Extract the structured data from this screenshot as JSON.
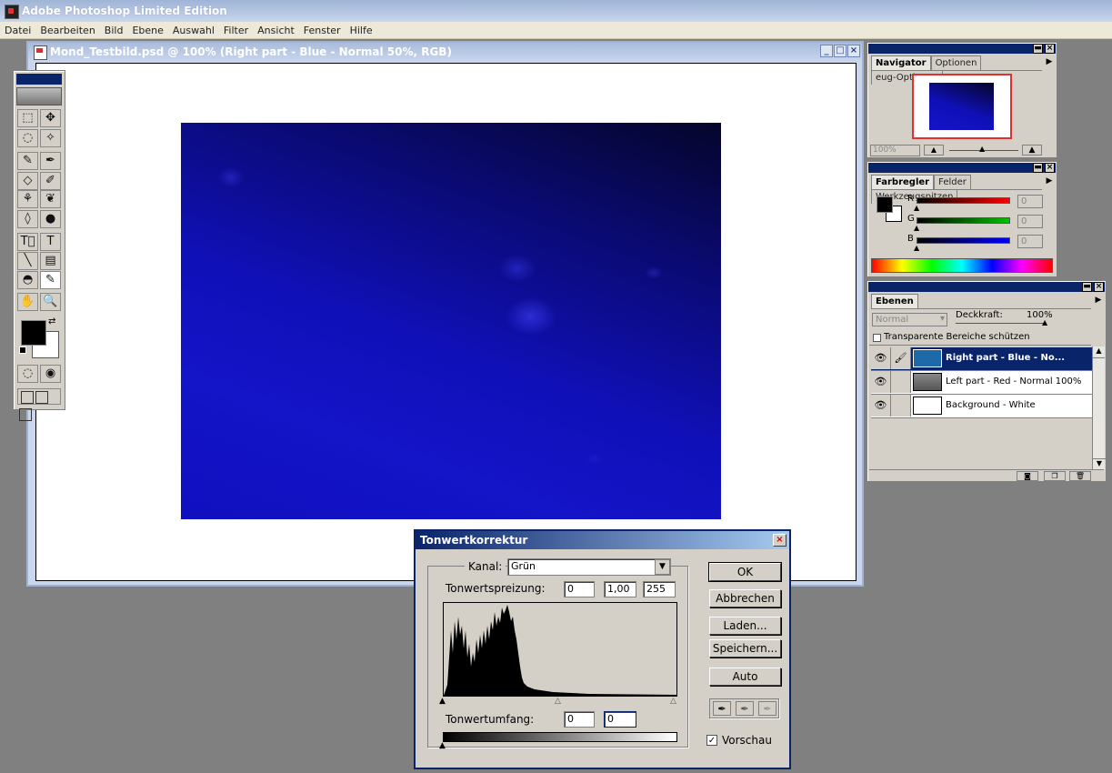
{
  "app": {
    "title": "Adobe Photoshop Limited Edition"
  },
  "menu": [
    "Datei",
    "Bearbeiten",
    "Bild",
    "Ebene",
    "Auswahl",
    "Filter",
    "Ansicht",
    "Fenster",
    "Hilfe"
  ],
  "document": {
    "title": "Mond_Testbild.psd @ 100%  (Right part - Blue - Normal 50%, RGB)",
    "min": "_",
    "max": "□",
    "close": "×"
  },
  "navigator": {
    "tabs": [
      "Navigator",
      "Optionen",
      "eug-Optionen"
    ],
    "zoom": "100%",
    "frame_color": "#e03030"
  },
  "color": {
    "tabs": [
      "Farbregler",
      "Felder",
      "Werkzeugspitzen"
    ],
    "channels": [
      {
        "label": "R",
        "value": "0",
        "color": "#ff0000"
      },
      {
        "label": "G",
        "value": "0",
        "color": "#00c000"
      },
      {
        "label": "B",
        "value": "0",
        "color": "#0000ff"
      }
    ]
  },
  "layers": {
    "tab": "Ebenen",
    "mode": "Normal",
    "opacity_label": "Deckkraft:",
    "opacity_value": "100%",
    "preserve_label": "Transparente Bereiche schützen",
    "rows": [
      {
        "name": "Right part - Blue - No...",
        "selected": true,
        "eye": "👁",
        "link": "🖌"
      },
      {
        "name": "Left part - Red - Normal 100%",
        "selected": false,
        "eye": "👁",
        "link": ""
      },
      {
        "name": "Background - White",
        "selected": false,
        "eye": "👁",
        "link": ""
      }
    ]
  },
  "dialog": {
    "title": "Tonwertkorrektur",
    "close": "×",
    "channel_label": "Kanal:",
    "channel_value": "Grün",
    "input_levels_label": "Tonwertspreizung:",
    "input_levels": [
      "0",
      "1,00",
      "255"
    ],
    "output_levels_label": "Tonwertumfang:",
    "output_levels": [
      "0",
      "0"
    ],
    "buttons": {
      "ok": "OK",
      "cancel": "Abbrechen",
      "load": "Laden...",
      "save": "Speichern...",
      "auto": "Auto"
    },
    "preview_label": "Vorschau",
    "preview_checked": "✓"
  },
  "toolbox": {
    "tools": [
      "⬚",
      "✥",
      "◌",
      "✧",
      "✎",
      "✒",
      "◇",
      "✐",
      "⚘",
      "❦",
      "◊",
      "●",
      "T⃞",
      "T",
      "╲",
      "▤",
      "◓",
      "✎",
      "✋",
      "🔍"
    ]
  }
}
